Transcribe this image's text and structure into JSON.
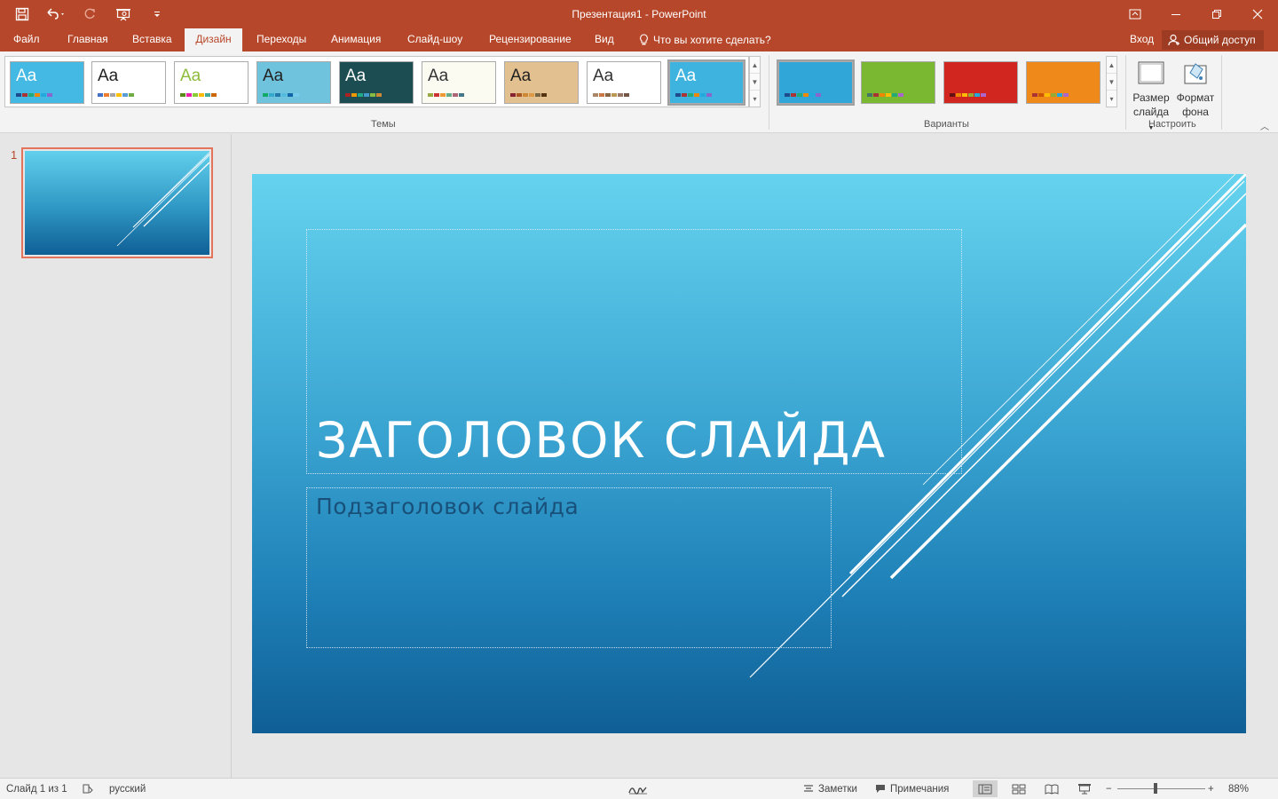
{
  "window": {
    "title": "Презентация1 - PowerPoint"
  },
  "tabs": [
    {
      "label": "Файл"
    },
    {
      "label": "Главная"
    },
    {
      "label": "Вставка"
    },
    {
      "label": "Дизайн"
    },
    {
      "label": "Переходы"
    },
    {
      "label": "Анимация"
    },
    {
      "label": "Слайд-шоу"
    },
    {
      "label": "Рецензирование"
    },
    {
      "label": "Вид"
    }
  ],
  "active_tab": "Дизайн",
  "tell_me": "Что вы хотите сделать?",
  "signin": "Вход",
  "share": "Общий доступ",
  "ribbon": {
    "themes_label": "Темы",
    "variants_label": "Варианты",
    "customize_label": "Настроить",
    "theme_aa": "Aa",
    "slide_size": {
      "line1": "Размер",
      "line2": "слайда"
    },
    "format_bg": {
      "line1": "Формат",
      "line2": "фона"
    }
  },
  "themes": [
    {
      "name": "theme-facet",
      "bg": "#43b9e3",
      "fg": "#ffffff",
      "bars": [
        "#1e4b8c",
        "#a33",
        "#2a7",
        "#e80",
        "#2ad",
        "#86c"
      ]
    },
    {
      "name": "theme-office",
      "bg": "#ffffff",
      "fg": "#222222",
      "bars": [
        "#4472c4",
        "#ed7d31",
        "#a5a5a5",
        "#ffc000",
        "#5b9bd5",
        "#70ad47"
      ]
    },
    {
      "name": "theme-green",
      "bg": "#ffffff",
      "fg": "#8dbd3a",
      "bars": [
        "#5a8a1a",
        "#e2a",
        "#8c3",
        "#fb0",
        "#4a9",
        "#c60"
      ]
    },
    {
      "name": "theme-pattern",
      "bg": "#6fc3dd",
      "fg": "#222222",
      "bars": [
        "#1a6",
        "#3ac",
        "#27a",
        "#5bd",
        "#16a",
        "#7ce"
      ]
    },
    {
      "name": "theme-dark-teal",
      "bg": "#1c4d52",
      "fg": "#ffffff",
      "bars": [
        "#a22",
        "#e90",
        "#2a8",
        "#49c",
        "#8b4",
        "#c83"
      ]
    },
    {
      "name": "theme-ion",
      "bg": "#fbfbf2",
      "fg": "#333333",
      "bars": [
        "#9a4",
        "#c33",
        "#e93",
        "#6a8",
        "#a67",
        "#478"
      ]
    },
    {
      "name": "theme-wood",
      "bg": "#e3c08f",
      "fg": "#222222",
      "bars": [
        "#823",
        "#a52",
        "#c83",
        "#d94",
        "#764",
        "#531"
      ]
    },
    {
      "name": "theme-retro",
      "bg": "#ffffff",
      "fg": "#333333",
      "bars": [
        "#a86",
        "#c74",
        "#864",
        "#b95",
        "#976",
        "#754"
      ]
    },
    {
      "name": "theme-facet-selected",
      "bg": "#3fb3df",
      "fg": "#ffffff",
      "bars": [
        "#1e4b8c",
        "#a33",
        "#2a7",
        "#e80",
        "#2ad",
        "#86c"
      ]
    }
  ],
  "variants": [
    {
      "name": "variant-blue",
      "bg": "#2fa5d8",
      "bars": [
        "#1e4b8c",
        "#a33",
        "#2a7",
        "#e80",
        "#2ad",
        "#86c"
      ]
    },
    {
      "name": "variant-green",
      "bg": "#7ab832",
      "bars": [
        "#476",
        "#a33",
        "#e80",
        "#fb0",
        "#2a7",
        "#a6c"
      ]
    },
    {
      "name": "variant-red",
      "bg": "#d0261f",
      "bars": [
        "#611",
        "#e80",
        "#fb0",
        "#9a3",
        "#2ad",
        "#a6c"
      ]
    },
    {
      "name": "variant-orange",
      "bg": "#ef8a1a",
      "bars": [
        "#a33",
        "#c50",
        "#fb0",
        "#9a3",
        "#2ad",
        "#a6c"
      ]
    }
  ],
  "slide_panel": {
    "number": "1"
  },
  "slide": {
    "title": "ЗАГОЛОВОК СЛАЙДА",
    "subtitle": "Подзаголовок слайда"
  },
  "status": {
    "slide_info": "Слайд 1 из 1",
    "language": "русский",
    "notes": "Заметки",
    "comments": "Примечания",
    "zoom": "88%"
  }
}
